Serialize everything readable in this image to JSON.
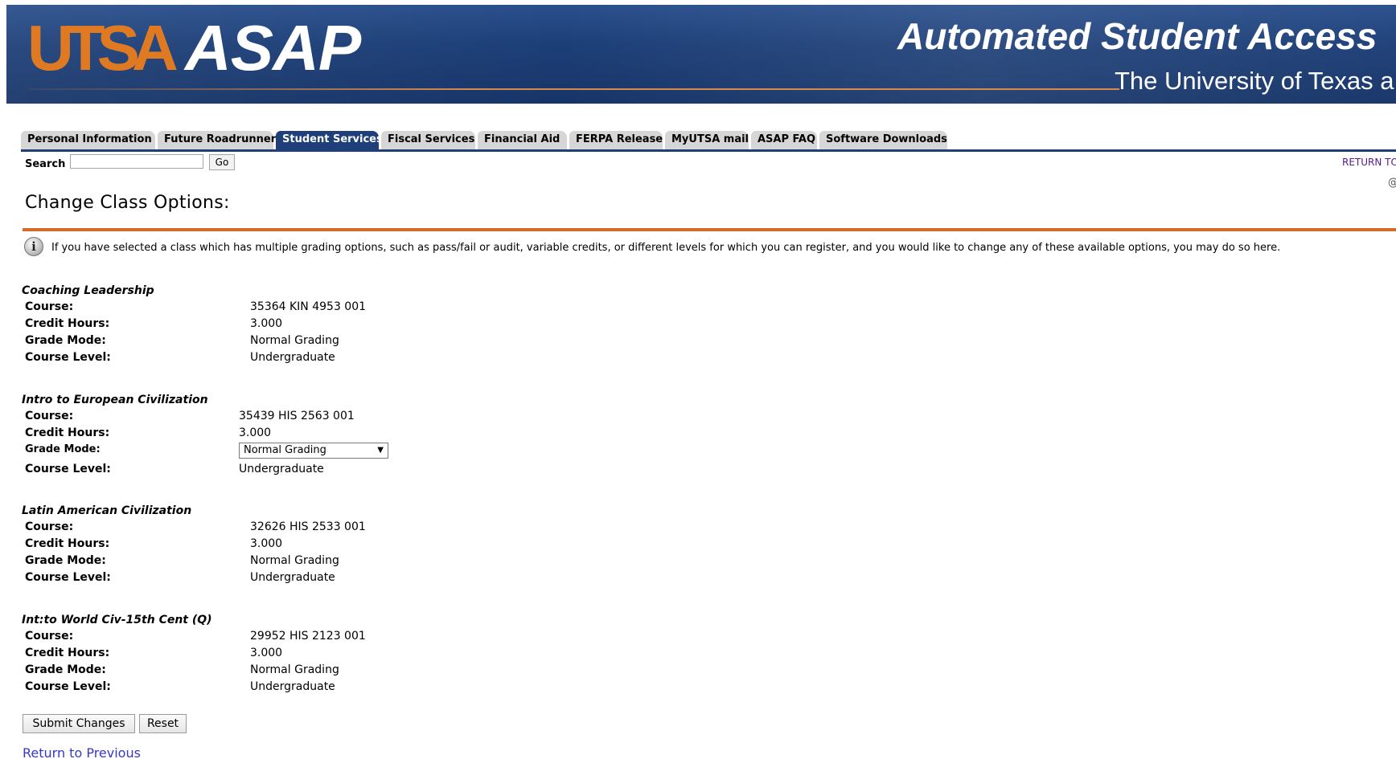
{
  "banner": {
    "logo_utsa": "UTSA",
    "logo_asap": "ASAP",
    "title": "Automated Student Access",
    "subtitle": "The University of Texas a"
  },
  "tabs": [
    {
      "label": "Personal Information",
      "active": false
    },
    {
      "label": "Future Roadrunner",
      "active": false
    },
    {
      "label": "Student Services",
      "active": true
    },
    {
      "label": "Fiscal Services",
      "active": false
    },
    {
      "label": "Financial Aid",
      "active": false
    },
    {
      "label": "FERPA Release",
      "active": false
    },
    {
      "label": "MyUTSA mail",
      "active": false
    },
    {
      "label": "ASAP FAQ",
      "active": false
    },
    {
      "label": "Software Downloads",
      "active": false
    }
  ],
  "search": {
    "label": "Search",
    "value": "",
    "button": "Go"
  },
  "return_top": "RETURN TO",
  "edge_glyph": "@",
  "page": {
    "title": "Change Class Options:",
    "info_icon": "i",
    "info_text": "If you have selected a class which has multiple grading options, such as pass/fail or audit, variable credits, or different levels for which you can register, and you would like to change any of these available options, you may do so here."
  },
  "labels": {
    "course": "Course:",
    "credit_hours": "Credit Hours:",
    "grade_mode": "Grade Mode:",
    "course_level": "Course Level:"
  },
  "classes": [
    {
      "title": "Coaching Leadership",
      "course": "35364 KIN 4953 001",
      "credit_hours": "3.000",
      "grade_mode": "Normal Grading",
      "course_level": "Undergraduate"
    },
    {
      "title": "Intro to European Civilization",
      "course": "35439 HIS 2563 001",
      "credit_hours": "3.000",
      "grade_mode": "Normal Grading",
      "course_level": "Undergraduate"
    },
    {
      "title": "Latin American Civilization",
      "course": "32626 HIS 2533 001",
      "credit_hours": "3.000",
      "grade_mode": "Normal Grading",
      "course_level": "Undergraduate"
    },
    {
      "title": "Int:to World Civ-15th Cent (Q)",
      "course": "29952 HIS 2123 001",
      "credit_hours": "3.000",
      "grade_mode": "Normal Grading",
      "course_level": "Undergraduate"
    }
  ],
  "actions": {
    "submit": "Submit Changes",
    "reset": "Reset",
    "return_previous": "Return to Previous"
  }
}
